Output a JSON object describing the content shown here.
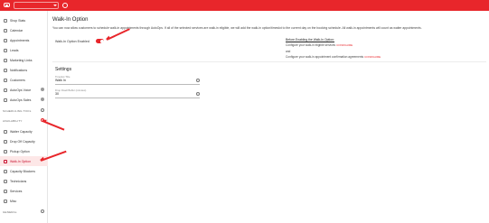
{
  "header": {
    "logo_icon": "brand-logo-icon",
    "search_icon": "search-icon",
    "notification_icon": "bell-icon",
    "brand_color": "#e8262b"
  },
  "sidebar": {
    "items": [
      {
        "label": "Shop Stats",
        "icon": "chart-icon"
      },
      {
        "label": "Calendar",
        "icon": "calendar-icon"
      },
      {
        "label": "Appointments",
        "icon": "appointments-icon"
      },
      {
        "label": "Leads",
        "icon": "leads-icon"
      },
      {
        "label": "Marketing Links",
        "icon": "link-icon"
      },
      {
        "label": "Notifications",
        "icon": "notification-icon"
      },
      {
        "label": "Customers",
        "icon": "customers-icon"
      },
      {
        "label": "AutoOps Voice",
        "icon": "voice-icon"
      },
      {
        "label": "AutoOps Sales",
        "icon": "sales-icon"
      }
    ],
    "scheduling_section": "SCHEDULING TOOL",
    "availability_section": "AVAILABILITY",
    "availability_items": [
      {
        "label": "Waiter Capacity",
        "icon": "waiter-icon"
      },
      {
        "label": "Drop Off Capacity",
        "icon": "drop-off-icon"
      },
      {
        "label": "Pickup Option",
        "icon": "pickup-icon"
      },
      {
        "label": "Walk-In Option",
        "icon": "walk-in-icon",
        "active": true
      },
      {
        "label": "Capacity Blockers",
        "icon": "blocker-icon"
      },
      {
        "label": "Technicians",
        "icon": "technician-icon"
      },
      {
        "label": "Services",
        "icon": "services-icon"
      },
      {
        "label": "Misc",
        "icon": "misc-icon"
      }
    ],
    "general_section": "GENERAL"
  },
  "main": {
    "title": "Walk-In Option",
    "description": "You can now allow customers to schedule walk-in appointments through AutoOps. If all of the selected services are walk-in eligible, we will add the walk-in option/timeslot to the current day on the booking schedule. All walk-in appointments will count as waiter appointments.",
    "toggle_label": "Walk-In Option Enabled",
    "toggle_on": true,
    "before": {
      "title": "Before Enabling the Walk-In Option:",
      "step1": "Configure your walk-in eligible services",
      "step1_link": "CONFIGURE",
      "and": "and",
      "step2": "Configure your walk-in appointment confirmation agreements",
      "step2_link": "CONFIGURE"
    },
    "settings": {
      "title": "Settings",
      "field1_label": "Timeslot Title",
      "field1_value": "Walk In",
      "field2_label": "Drop Dwell Buffer (minutes)",
      "field2_value": "30"
    }
  }
}
